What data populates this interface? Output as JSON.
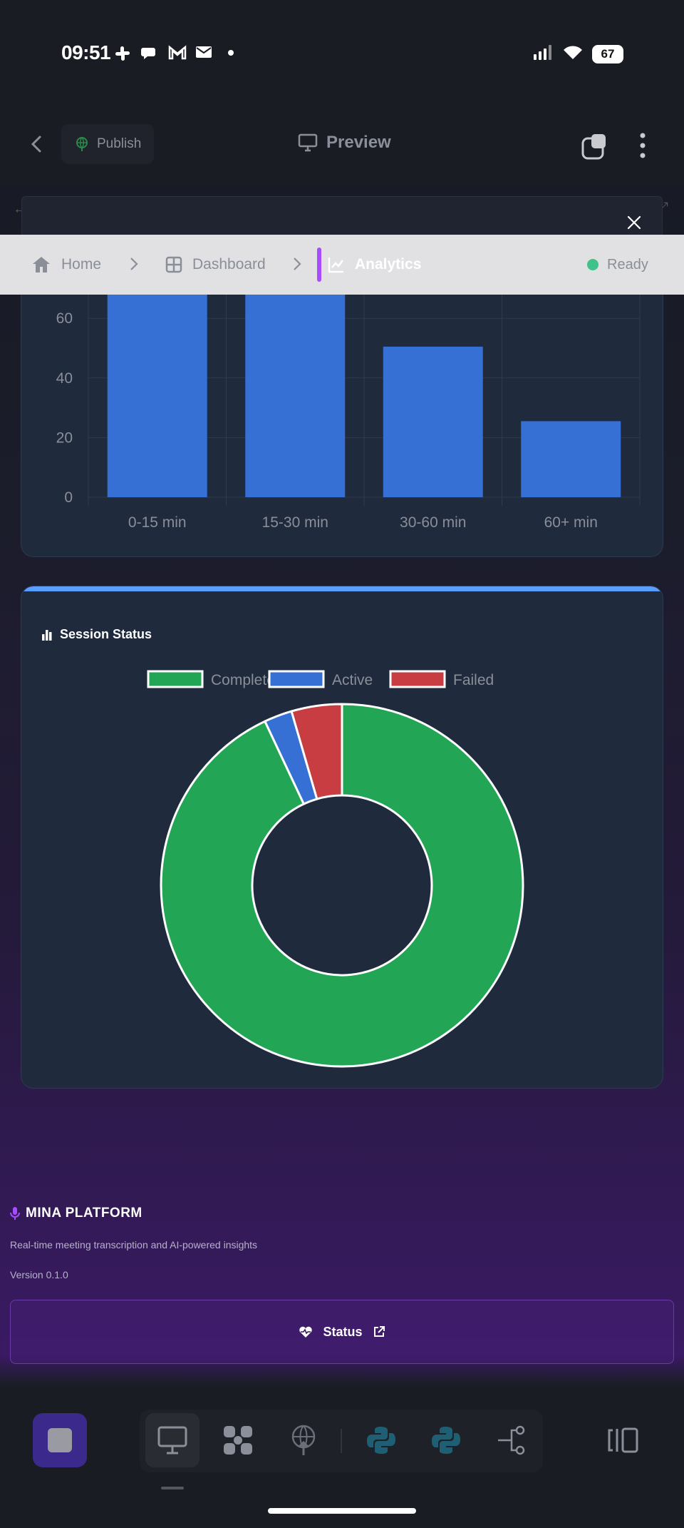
{
  "status_bar": {
    "time": "09:51",
    "battery": "67"
  },
  "app_bar": {
    "publish_label": "Publish",
    "preview_label": "Preview"
  },
  "breadcrumb": {
    "items": [
      {
        "label": "Home"
      },
      {
        "label": "Dashboard"
      },
      {
        "label": "Analytics"
      }
    ],
    "status": "Ready"
  },
  "duration_card": {
    "chart_data": {
      "type": "bar",
      "categories": [
        "0-15 min",
        "15-30 min",
        "30-60 min",
        "60+ min"
      ],
      "values": [
        72,
        75,
        50.5,
        25.5
      ],
      "y_ticks": [
        "0",
        "20",
        "40",
        "60"
      ],
      "ylim": [
        0,
        80
      ],
      "bar_color": "#3670d4"
    }
  },
  "status_card": {
    "title": "Session Status",
    "chart_data": {
      "type": "pie",
      "donut": true,
      "categories": [
        "Completed",
        "Active",
        "Failed"
      ],
      "values": [
        93,
        2.5,
        4.5
      ],
      "colors": [
        "#22a555",
        "#3670d4",
        "#c73d42"
      ],
      "legend": "top"
    }
  },
  "footer": {
    "title": "MINA PLATFORM",
    "description": "Real-time meeting transcription and AI-powered insights",
    "version": "Version 0.1.0",
    "status_button": "Status"
  },
  "colors": {
    "accent": "#a64dff",
    "ready": "#3ec28a",
    "card_bg": "#1f2a3c"
  }
}
